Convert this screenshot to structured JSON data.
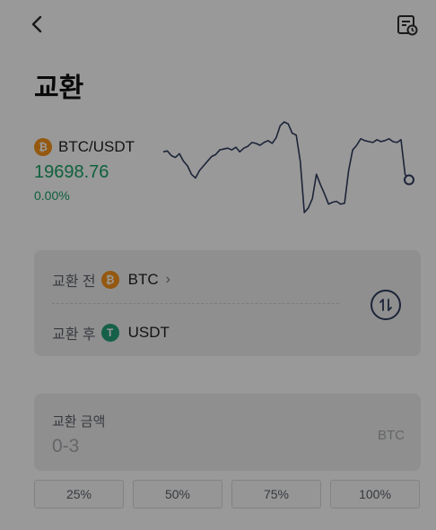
{
  "header": {
    "back_icon": "chevron-left-icon",
    "history_icon": "order-history-icon"
  },
  "page": {
    "title": "교환"
  },
  "ticker": {
    "pair": "BTC/USDT",
    "price": "19698.76",
    "change": "0.00%",
    "color": "#1aa167",
    "base_icon": "bitcoin-icon"
  },
  "sparkline": {
    "type": "line",
    "values": [
      40,
      39,
      44,
      46,
      42,
      50,
      55,
      64,
      68,
      60,
      55,
      50,
      45,
      43,
      38,
      37,
      36,
      38,
      35,
      40,
      36,
      34,
      30,
      31,
      33,
      30,
      28,
      31,
      25,
      12,
      8,
      10,
      20,
      22,
      50,
      105,
      100,
      90,
      64,
      75,
      85,
      96,
      94,
      93,
      96,
      95,
      60,
      38,
      33,
      26,
      28,
      29,
      30,
      27,
      29,
      28,
      26,
      29,
      30,
      27,
      64,
      70
    ],
    "color": "#2f3c5e"
  },
  "converter": {
    "from_label": "교환 전",
    "from_coin": "BTC",
    "from_coin_glyph": "₿",
    "to_label": "교환 후",
    "to_coin": "USDT",
    "to_coin_glyph": "T",
    "swap_icon": "swap-arrows-icon"
  },
  "amount": {
    "label": "교환 금액",
    "placeholder": "0-3",
    "unit": "BTC"
  },
  "percent_buttons": [
    "25%",
    "50%",
    "75%",
    "100%"
  ],
  "overlay": {
    "dim_color": "rgba(0,0,0,0.40)"
  }
}
